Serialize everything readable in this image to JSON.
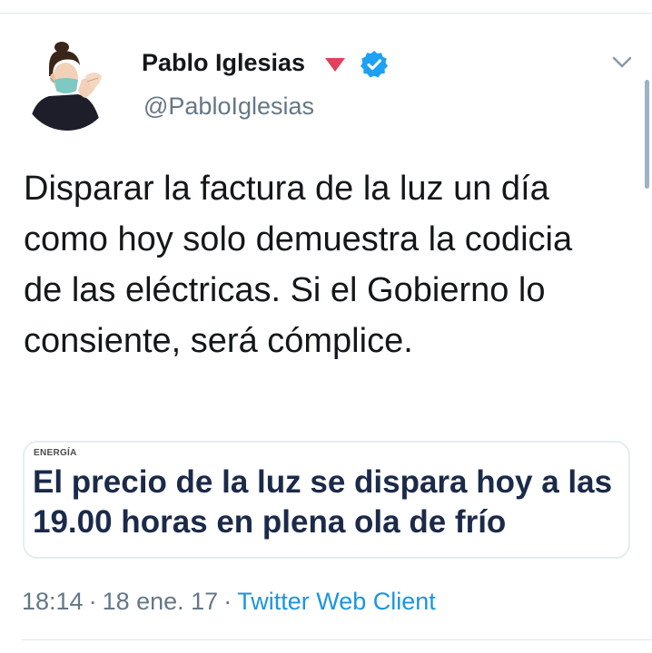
{
  "author": {
    "name": "Pablo Iglesias",
    "handle": "@PabloIglesias",
    "verified": true
  },
  "tweet": {
    "text": "Disparar la factura de la luz un día como hoy solo demuestra la codicia de las eléctricas. Si el Gobierno lo consiente, será cómplice."
  },
  "link_card": {
    "kicker": "ENERGÍA",
    "headline": "El precio de la luz se dispara hoy a las 19.00 horas en plena ola de frío"
  },
  "meta": {
    "time": "18:14",
    "date": "18 ene. 17",
    "source": "Twitter Web Client"
  },
  "colors": {
    "verified": "#1da1f2",
    "party_mark": "#e0415b",
    "link": "#1b95e0",
    "secondary_text": "#657786",
    "headline": "#1b2a49"
  },
  "icons": {
    "party": "down-triangle-icon",
    "verified": "verified-badge-icon",
    "menu": "chevron-down-icon"
  }
}
